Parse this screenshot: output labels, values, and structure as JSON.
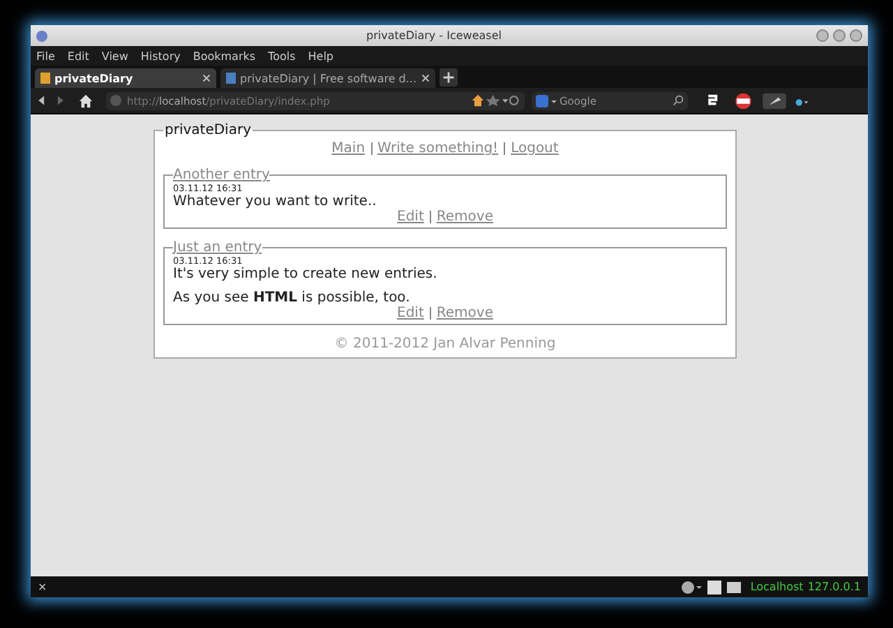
{
  "window": {
    "title": "privateDiary - Iceweasel"
  },
  "menu": [
    "File",
    "Edit",
    "View",
    "History",
    "Bookmarks",
    "Tools",
    "Help"
  ],
  "tabs": [
    {
      "label": "privateDiary",
      "selected": true
    },
    {
      "label": "privateDiary | Free software d...",
      "selected": false
    }
  ],
  "address": {
    "host_prefix": "http://",
    "host": "localhost",
    "path": "/privateDiary/index.php"
  },
  "search": {
    "placeholder": "Google"
  },
  "page": {
    "title": "privateDiary",
    "nav": [
      "Main",
      "Write something!",
      "Logout"
    ],
    "entries": [
      {
        "title": "Another entry",
        "date": "03.11.12 16:31",
        "paragraphs": [
          "Whatever you want to write.."
        ],
        "actions": [
          "Edit",
          "Remove"
        ]
      },
      {
        "title": "Just an entry",
        "date": "03.11.12 16:31",
        "paragraphs": [
          "It's very simple to create new entries.",
          "As you see **HTML** is possible, too."
        ],
        "actions": [
          "Edit",
          "Remove"
        ]
      }
    ],
    "footer": "© 2011-2012 Jan Alvar Penning"
  },
  "status_bar": {
    "close": "×",
    "host": "Localhost",
    "ip": "127.0.0.1"
  }
}
